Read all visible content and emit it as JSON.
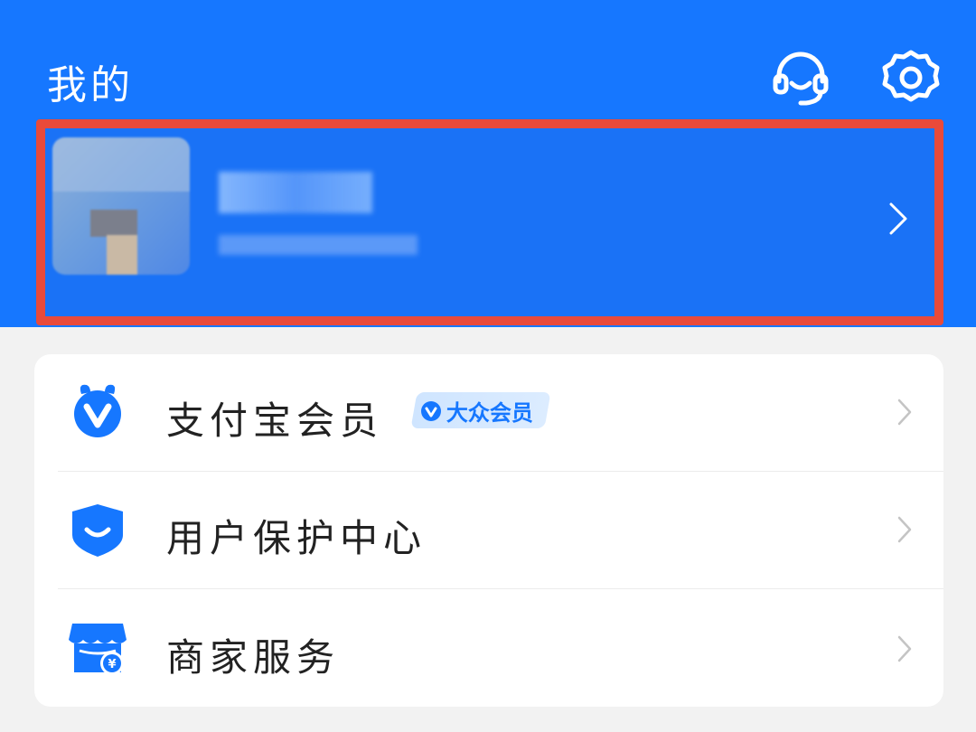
{
  "header": {
    "title": "我的",
    "icons": [
      "customer-service-icon",
      "gear-icon"
    ],
    "background_color": "#1677ff"
  },
  "profile": {
    "highlight_color": "#e94a3a",
    "chevron_icon": "chevron-right-icon"
  },
  "menu": {
    "items": [
      {
        "icon": "member-icon",
        "label": "支付宝会员",
        "badge": "大众会员"
      },
      {
        "icon": "shield-icon",
        "label": "用户保护中心"
      },
      {
        "icon": "store-icon",
        "label": "商家服务"
      }
    ]
  },
  "colors": {
    "accent": "#1677ff",
    "chevron": "#c4c4c4"
  }
}
